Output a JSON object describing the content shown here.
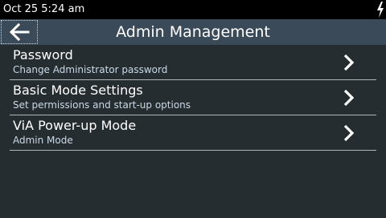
{
  "status_bar": {
    "time": "Oct 25 5:24 am",
    "charging_icon": "lightning-bolt-icon"
  },
  "header": {
    "title": "Admin Management",
    "back_icon": "arrow-left-icon"
  },
  "menu": {
    "items": [
      {
        "title": "Password",
        "subtitle": "Change Administrator password",
        "icon": "chevron-right-icon"
      },
      {
        "title": "Basic Mode Settings",
        "subtitle": "Set permissions and start-up options",
        "icon": "chevron-right-icon"
      },
      {
        "title": "ViA Power-up Mode",
        "subtitle": "Admin Mode",
        "icon": "chevron-right-icon"
      }
    ]
  },
  "colors": {
    "background": "#262d30",
    "status_bar": "#000000",
    "header": "#3b4a59",
    "divider": "#aeb6bb",
    "subtitle": "#c9d9e6"
  }
}
